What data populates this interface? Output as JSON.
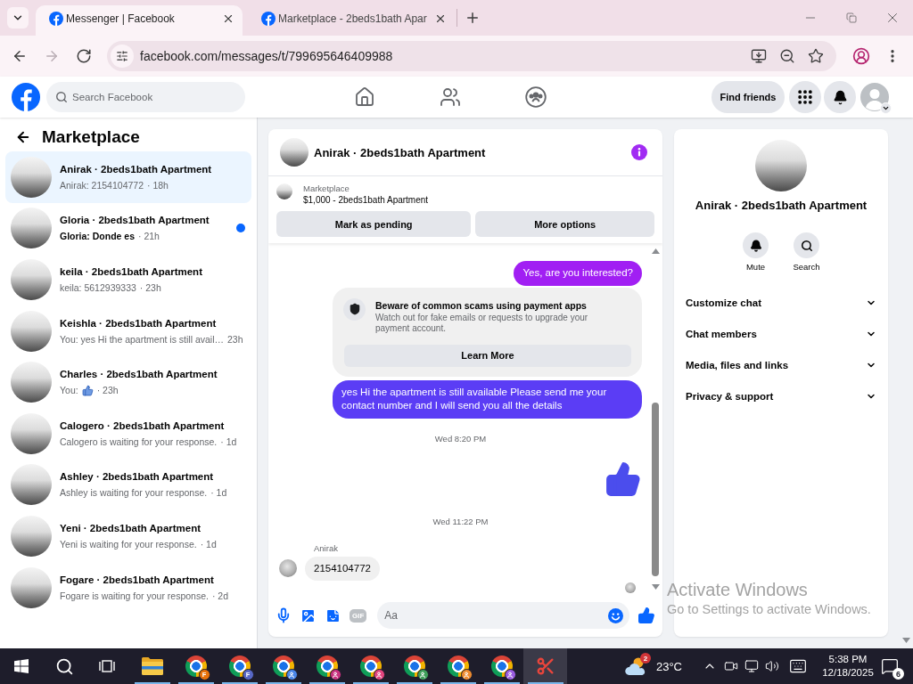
{
  "tabs": [
    {
      "title": "Messenger | Facebook",
      "selected": true
    },
    {
      "title": "Marketplace - 2beds1bath Apar",
      "selected": false
    }
  ],
  "toolbar": {
    "buttons": [
      {
        "kind": "back",
        "disabled": false
      },
      {
        "kind": "forward",
        "disabled": true
      },
      {
        "kind": "reload",
        "disabled": false
      }
    ],
    "url": "facebook.com/messages/t/799695646409988"
  },
  "header": {
    "search": {
      "placeholder": "Search Facebook"
    },
    "find_friends": "Find friends"
  },
  "sidebar": {
    "title": "Marketplace",
    "conversations": [
      {
        "title": "Anirak · 2beds1bath Apartment",
        "kind": "text",
        "preview": "Anirak: 2154104772",
        "time": "· 18h",
        "selected": true,
        "unread": false
      },
      {
        "title": "Gloria · 2beds1bath Apartment",
        "kind": "text",
        "preview": "Gloria: Donde es",
        "time": "· 21h",
        "selected": false,
        "unread": true
      },
      {
        "title": "keila · 2beds1bath Apartment",
        "kind": "text",
        "preview": "keila: 5612939333",
        "time": "· 23h",
        "selected": false,
        "unread": false
      },
      {
        "title": "Keishla · 2beds1bath Apartment",
        "kind": "text",
        "preview": "You: yes Hi the apartment is still avail…",
        "time": "23h",
        "selected": false,
        "unread": false
      },
      {
        "title": "Charles · 2beds1bath Apartment",
        "kind": "like",
        "preview": "You:",
        "time": "· 23h",
        "selected": false,
        "unread": false
      },
      {
        "title": "Calogero · 2beds1bath Apartment",
        "kind": "text",
        "preview": "Calogero is waiting for your response.",
        "time": "· 1d",
        "selected": false,
        "unread": false
      },
      {
        "title": "Ashley · 2beds1bath Apartment",
        "kind": "text",
        "preview": "Ashley is waiting for your response.",
        "time": "· 1d",
        "selected": false,
        "unread": false
      },
      {
        "title": "Yeni · 2beds1bath Apartment",
        "kind": "text",
        "preview": "Yeni is waiting for your response.",
        "time": "· 1d",
        "selected": false,
        "unread": false
      },
      {
        "title": "Fogare · 2beds1bath Apartment",
        "kind": "text",
        "preview": "Fogare is waiting for your response.",
        "time": "· 2d",
        "selected": false,
        "unread": false
      }
    ]
  },
  "chat": {
    "title": "Anirak · 2beds1bath Apartment",
    "listing": {
      "source": "Marketplace",
      "summary": "$1,000 - 2beds1bath Apartment"
    },
    "actions": [
      "Mark as pending",
      "More options"
    ],
    "messages": [
      {
        "kind": "outgoing",
        "text": "Yes, are you interested?",
        "color": "#a11ff3"
      },
      {
        "kind": "notice",
        "title": "Beware of common scams using payment apps",
        "body": "Watch out for fake emails or requests to upgrade your payment account.",
        "button": "Learn More"
      },
      {
        "kind": "outgoing",
        "text": "yes Hi the apartment is still available Please send me your contact number and I will send you all the details",
        "color": "#5b3df5"
      },
      {
        "kind": "timestamp",
        "text": "Wed 8:20 PM"
      },
      {
        "kind": "like",
        "color": "#4b4ded"
      },
      {
        "kind": "timestamp",
        "text": "Wed 11:22 PM"
      },
      {
        "kind": "incoming",
        "sender": "Anirak",
        "text": "2154104772"
      },
      {
        "kind": "seen"
      }
    ],
    "composer": {
      "gif": "GIF",
      "placeholder": "Aa"
    }
  },
  "details": {
    "title": "Anirak · 2beds1bath Apartment",
    "actions": [
      {
        "kind": "mute",
        "label": "Mute"
      },
      {
        "kind": "search",
        "label": "Search"
      }
    ],
    "sections": [
      {
        "label": "Customize chat",
        "expanded": false
      },
      {
        "label": "Chat members",
        "expanded": false
      },
      {
        "label": "Media, files and links",
        "expanded": false
      },
      {
        "label": "Privacy & support",
        "expanded": false
      }
    ]
  },
  "activation_notice": {
    "title": "Activate Windows",
    "text": "Go to Settings to activate Windows."
  },
  "taskbar": {
    "apps": [
      {
        "kind": "folder",
        "running": true,
        "selected": false
      },
      {
        "kind": "browser",
        "badge": "F",
        "color": "#e8710a",
        "running": true,
        "selected": false
      },
      {
        "kind": "browser",
        "badge": "F",
        "color": "#5767c6",
        "running": true,
        "selected": false
      },
      {
        "kind": "browser",
        "color": "#4a86e8",
        "running": true,
        "selected": false
      },
      {
        "kind": "browser",
        "color": "#c8327f",
        "running": true,
        "selected": false
      },
      {
        "kind": "browser",
        "color": "#e2457f",
        "running": true,
        "selected": false
      },
      {
        "kind": "browser",
        "color": "#3f9f5a",
        "running": true,
        "selected": false
      },
      {
        "kind": "browser",
        "color": "#ee8b2f",
        "running": true,
        "selected": false
      },
      {
        "kind": "browser",
        "color": "#9a5ce0",
        "running": true,
        "selected": false
      },
      {
        "kind": "snipping",
        "running": true,
        "selected": true
      }
    ],
    "weather": {
      "badge": "2",
      "temperature": "23°C"
    },
    "clock": {
      "time": "5:38 PM",
      "date": "12/18/2025"
    },
    "notifications": "6"
  }
}
